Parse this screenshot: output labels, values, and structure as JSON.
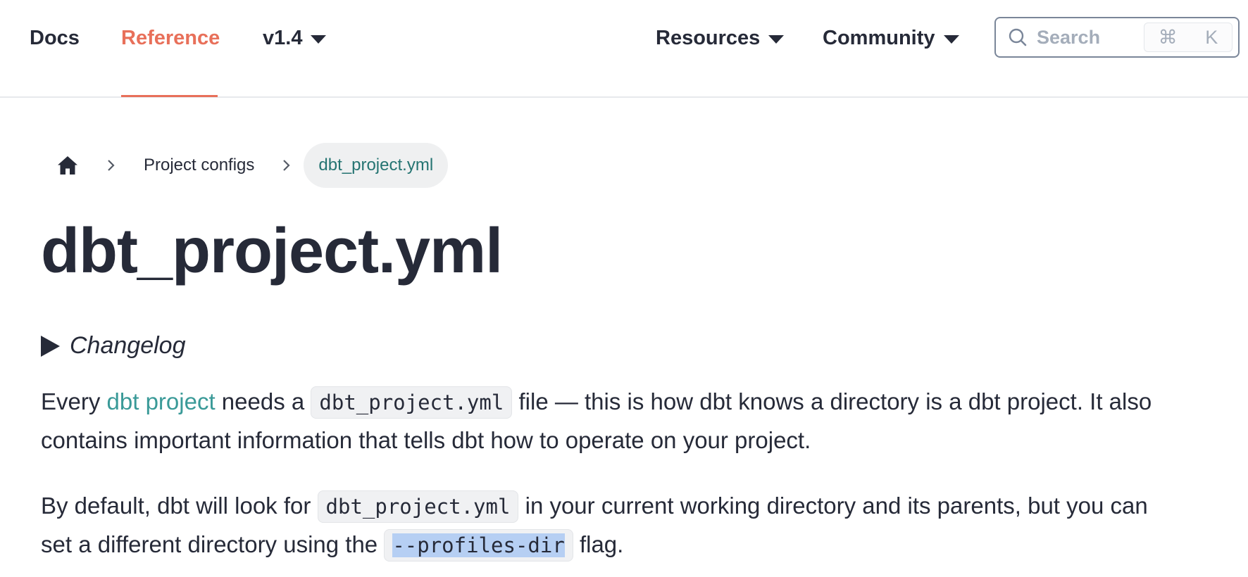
{
  "navbar": {
    "docs_label": "Docs",
    "reference_label": "Reference",
    "version_label": "v1.4",
    "resources_label": "Resources",
    "community_label": "Community",
    "search": {
      "placeholder": "Search",
      "shortcut_cmd": "⌘",
      "shortcut_key": "K"
    },
    "active_color": "#e8705a"
  },
  "breadcrumb": {
    "home_icon": "home-icon",
    "item1": "Project configs",
    "current": "dbt_project.yml"
  },
  "page": {
    "title": "dbt_project.yml",
    "changelog_label": "Changelog",
    "para1": {
      "t1": "Every ",
      "link": "dbt project",
      "t2": " needs a ",
      "code": "dbt_project.yml",
      "t3": " file — this is how dbt knows a directory is a dbt project. It also contains important information that tells dbt how to operate on your project."
    },
    "para2": {
      "t1": "By default, dbt will look for ",
      "code1": "dbt_project.yml",
      "t2": " in your current working directory and its parents, but you can set a different directory using the ",
      "code2": "--profiles-dir",
      "t3": " flag."
    },
    "link_color": "#3a9a98"
  }
}
